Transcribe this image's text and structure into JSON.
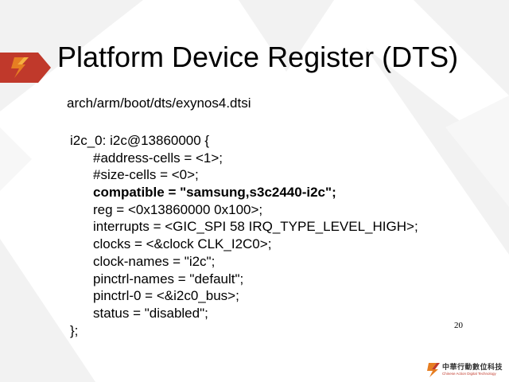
{
  "slide": {
    "title": "Platform Device Register (DTS)",
    "file_path": "arch/arm/boot/dts/exynos4.dtsi",
    "page_number": "20"
  },
  "code_lines": [
    {
      "text": "i2c_0: i2c@13860000 {",
      "indent": false,
      "bold": false
    },
    {
      "text": "#address-cells = <1>;",
      "indent": true,
      "bold": false
    },
    {
      "text": "#size-cells = <0>;",
      "indent": true,
      "bold": false
    },
    {
      "text": "compatible = \"samsung,s3c2440-i2c\";",
      "indent": true,
      "bold": true
    },
    {
      "text": "reg = <0x13860000 0x100>;",
      "indent": true,
      "bold": false
    },
    {
      "text": "interrupts = <GIC_SPI 58 IRQ_TYPE_LEVEL_HIGH>;",
      "indent": true,
      "bold": false
    },
    {
      "text": "clocks = <&clock CLK_I2C0>;",
      "indent": true,
      "bold": false
    },
    {
      "text": "clock-names = \"i2c\";",
      "indent": true,
      "bold": false
    },
    {
      "text": "pinctrl-names = \"default\";",
      "indent": true,
      "bold": false
    },
    {
      "text": "pinctrl-0 = <&i2c0_bus>;",
      "indent": true,
      "bold": false
    },
    {
      "text": "status = \"disabled\";",
      "indent": true,
      "bold": false
    },
    {
      "text": "};",
      "indent": false,
      "bold": false
    }
  ],
  "footer": {
    "company_cn": "中華行動數位科技",
    "company_en": "Chinese Action Digital Technology"
  },
  "colors": {
    "brand_red": "#c0392b",
    "brand_orange": "#e67e22",
    "text": "#000000"
  }
}
